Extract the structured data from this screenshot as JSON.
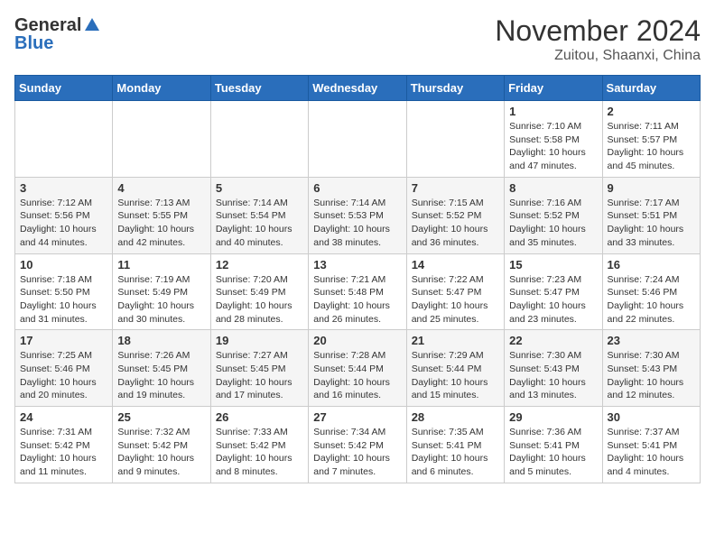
{
  "header": {
    "logo_general": "General",
    "logo_blue": "Blue",
    "month": "November 2024",
    "location": "Zuitou, Shaanxi, China"
  },
  "weekdays": [
    "Sunday",
    "Monday",
    "Tuesday",
    "Wednesday",
    "Thursday",
    "Friday",
    "Saturday"
  ],
  "weeks": [
    [
      {
        "day": "",
        "info": ""
      },
      {
        "day": "",
        "info": ""
      },
      {
        "day": "",
        "info": ""
      },
      {
        "day": "",
        "info": ""
      },
      {
        "day": "",
        "info": ""
      },
      {
        "day": "1",
        "info": "Sunrise: 7:10 AM\nSunset: 5:58 PM\nDaylight: 10 hours\nand 47 minutes."
      },
      {
        "day": "2",
        "info": "Sunrise: 7:11 AM\nSunset: 5:57 PM\nDaylight: 10 hours\nand 45 minutes."
      }
    ],
    [
      {
        "day": "3",
        "info": "Sunrise: 7:12 AM\nSunset: 5:56 PM\nDaylight: 10 hours\nand 44 minutes."
      },
      {
        "day": "4",
        "info": "Sunrise: 7:13 AM\nSunset: 5:55 PM\nDaylight: 10 hours\nand 42 minutes."
      },
      {
        "day": "5",
        "info": "Sunrise: 7:14 AM\nSunset: 5:54 PM\nDaylight: 10 hours\nand 40 minutes."
      },
      {
        "day": "6",
        "info": "Sunrise: 7:14 AM\nSunset: 5:53 PM\nDaylight: 10 hours\nand 38 minutes."
      },
      {
        "day": "7",
        "info": "Sunrise: 7:15 AM\nSunset: 5:52 PM\nDaylight: 10 hours\nand 36 minutes."
      },
      {
        "day": "8",
        "info": "Sunrise: 7:16 AM\nSunset: 5:52 PM\nDaylight: 10 hours\nand 35 minutes."
      },
      {
        "day": "9",
        "info": "Sunrise: 7:17 AM\nSunset: 5:51 PM\nDaylight: 10 hours\nand 33 minutes."
      }
    ],
    [
      {
        "day": "10",
        "info": "Sunrise: 7:18 AM\nSunset: 5:50 PM\nDaylight: 10 hours\nand 31 minutes."
      },
      {
        "day": "11",
        "info": "Sunrise: 7:19 AM\nSunset: 5:49 PM\nDaylight: 10 hours\nand 30 minutes."
      },
      {
        "day": "12",
        "info": "Sunrise: 7:20 AM\nSunset: 5:49 PM\nDaylight: 10 hours\nand 28 minutes."
      },
      {
        "day": "13",
        "info": "Sunrise: 7:21 AM\nSunset: 5:48 PM\nDaylight: 10 hours\nand 26 minutes."
      },
      {
        "day": "14",
        "info": "Sunrise: 7:22 AM\nSunset: 5:47 PM\nDaylight: 10 hours\nand 25 minutes."
      },
      {
        "day": "15",
        "info": "Sunrise: 7:23 AM\nSunset: 5:47 PM\nDaylight: 10 hours\nand 23 minutes."
      },
      {
        "day": "16",
        "info": "Sunrise: 7:24 AM\nSunset: 5:46 PM\nDaylight: 10 hours\nand 22 minutes."
      }
    ],
    [
      {
        "day": "17",
        "info": "Sunrise: 7:25 AM\nSunset: 5:46 PM\nDaylight: 10 hours\nand 20 minutes."
      },
      {
        "day": "18",
        "info": "Sunrise: 7:26 AM\nSunset: 5:45 PM\nDaylight: 10 hours\nand 19 minutes."
      },
      {
        "day": "19",
        "info": "Sunrise: 7:27 AM\nSunset: 5:45 PM\nDaylight: 10 hours\nand 17 minutes."
      },
      {
        "day": "20",
        "info": "Sunrise: 7:28 AM\nSunset: 5:44 PM\nDaylight: 10 hours\nand 16 minutes."
      },
      {
        "day": "21",
        "info": "Sunrise: 7:29 AM\nSunset: 5:44 PM\nDaylight: 10 hours\nand 15 minutes."
      },
      {
        "day": "22",
        "info": "Sunrise: 7:30 AM\nSunset: 5:43 PM\nDaylight: 10 hours\nand 13 minutes."
      },
      {
        "day": "23",
        "info": "Sunrise: 7:30 AM\nSunset: 5:43 PM\nDaylight: 10 hours\nand 12 minutes."
      }
    ],
    [
      {
        "day": "24",
        "info": "Sunrise: 7:31 AM\nSunset: 5:42 PM\nDaylight: 10 hours\nand 11 minutes."
      },
      {
        "day": "25",
        "info": "Sunrise: 7:32 AM\nSunset: 5:42 PM\nDaylight: 10 hours\nand 9 minutes."
      },
      {
        "day": "26",
        "info": "Sunrise: 7:33 AM\nSunset: 5:42 PM\nDaylight: 10 hours\nand 8 minutes."
      },
      {
        "day": "27",
        "info": "Sunrise: 7:34 AM\nSunset: 5:42 PM\nDaylight: 10 hours\nand 7 minutes."
      },
      {
        "day": "28",
        "info": "Sunrise: 7:35 AM\nSunset: 5:41 PM\nDaylight: 10 hours\nand 6 minutes."
      },
      {
        "day": "29",
        "info": "Sunrise: 7:36 AM\nSunset: 5:41 PM\nDaylight: 10 hours\nand 5 minutes."
      },
      {
        "day": "30",
        "info": "Sunrise: 7:37 AM\nSunset: 5:41 PM\nDaylight: 10 hours\nand 4 minutes."
      }
    ]
  ]
}
